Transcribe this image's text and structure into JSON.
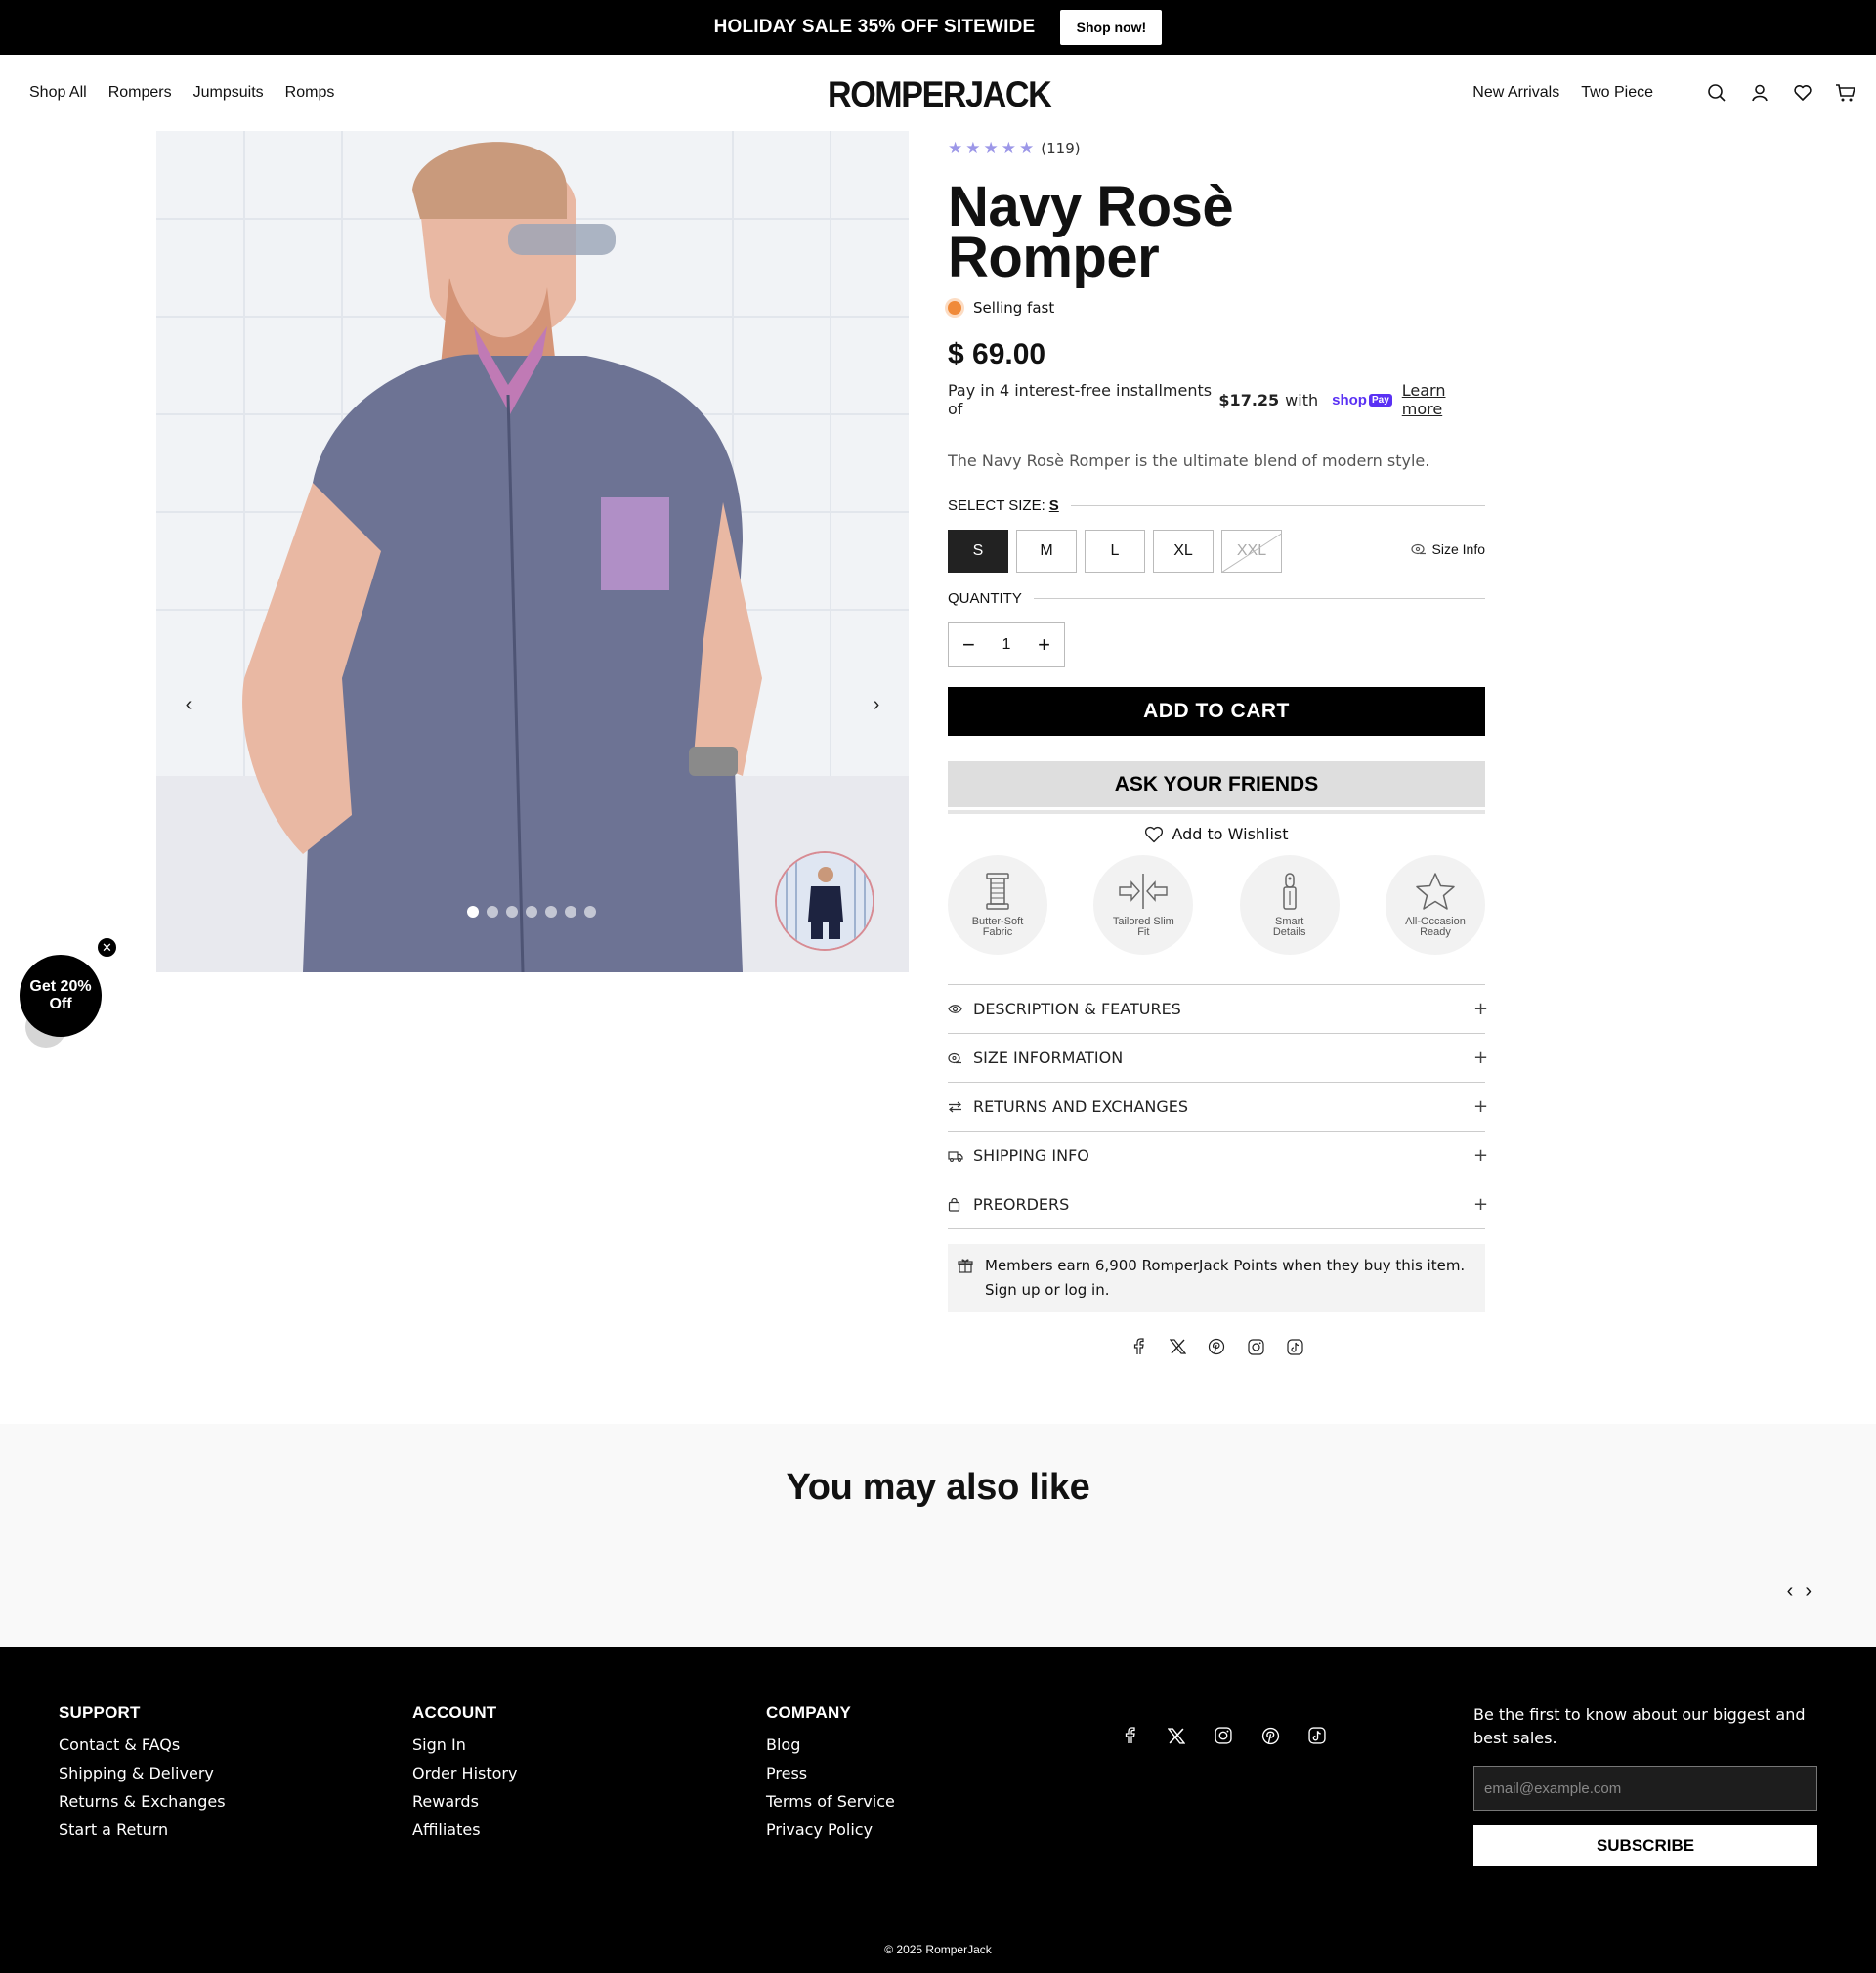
{
  "announcement": {
    "text": "HOLIDAY SALE 35% OFF SITEWIDE",
    "button": "Shop now!"
  },
  "header": {
    "logo": "ROMPERJACK",
    "nav_left": [
      "Shop All",
      "Rompers",
      "Jumpsuits",
      "Romps"
    ],
    "nav_right": [
      "New Arrivals",
      "Two Piece"
    ],
    "icons": [
      "search-icon",
      "account-icon",
      "wishlist-icon",
      "cart-icon"
    ]
  },
  "gallery": {
    "dots": 7,
    "active_dot": 1
  },
  "promo": {
    "text": "Get 20% Off",
    "close": "✕"
  },
  "product": {
    "rating_stars": 5,
    "review_count": "(119)",
    "title_line1": "Navy Rosè",
    "title_line2": "Romper",
    "stock_status": "Selling fast",
    "price": "$ 69.00",
    "installments_prefix": "Pay in 4 interest-free installments of",
    "installment_amount": "$17.25",
    "installments_with": "with",
    "shoppay_label": "shop",
    "shoppay_badge": "Pay",
    "learn_more": "Learn more",
    "description": "The Navy Rosè Romper is the ultimate blend of modern style.",
    "size_label": "SELECT SIZE:",
    "selected_size": "S",
    "sizes": [
      "S",
      "M",
      "L",
      "XL",
      "XXL"
    ],
    "size_info": "Size Info",
    "quantity_label": "QUANTITY",
    "quantity": "1",
    "add_to_cart": "ADD TO CART",
    "ask_friends": "ASK YOUR FRIENDS",
    "add_to_wishlist": "Add to Wishlist",
    "features": [
      {
        "line1": "Butter-Soft",
        "line2": "Fabric"
      },
      {
        "line1": "Tailored Slim",
        "line2": "Fit"
      },
      {
        "line1": "Smart",
        "line2": "Details"
      },
      {
        "line1": "All-Occasion",
        "line2": "Ready"
      }
    ],
    "accordion": [
      "DESCRIPTION & FEATURES",
      "SIZE INFORMATION",
      "RETURNS AND EXCHANGES",
      "SHIPPING INFO",
      "PREORDERS"
    ],
    "points_line1": "Members earn 6,900 RomperJack Points when they buy this item.",
    "points_line2": "Sign up or log in."
  },
  "share_icons": [
    "facebook-icon",
    "x-icon",
    "pinterest-icon",
    "instagram-icon",
    "tiktok-icon"
  ],
  "also_like": {
    "title": "You may also like"
  },
  "footer": {
    "support": {
      "title": "SUPPORT",
      "links": [
        "Contact & FAQs",
        "Shipping & Delivery",
        "Returns & Exchanges",
        "Start a Return"
      ]
    },
    "account": {
      "title": "ACCOUNT",
      "links": [
        "Sign In",
        "Order History",
        "Rewards",
        "Affiliates"
      ]
    },
    "company": {
      "title": "COMPANY",
      "links": [
        "Blog",
        "Press",
        "Terms of Service",
        "Privacy Policy"
      ]
    },
    "newsletter_text": "Be the first to know about our biggest and best sales.",
    "email_placeholder": "email@example.com",
    "subscribe": "SUBSCRIBE",
    "copyright": "© 2025 RomperJack"
  },
  "colors": {
    "accent_star": "#9c97e8",
    "selling_dot": "#f08a3a",
    "shoppay": "#5a31f4"
  }
}
